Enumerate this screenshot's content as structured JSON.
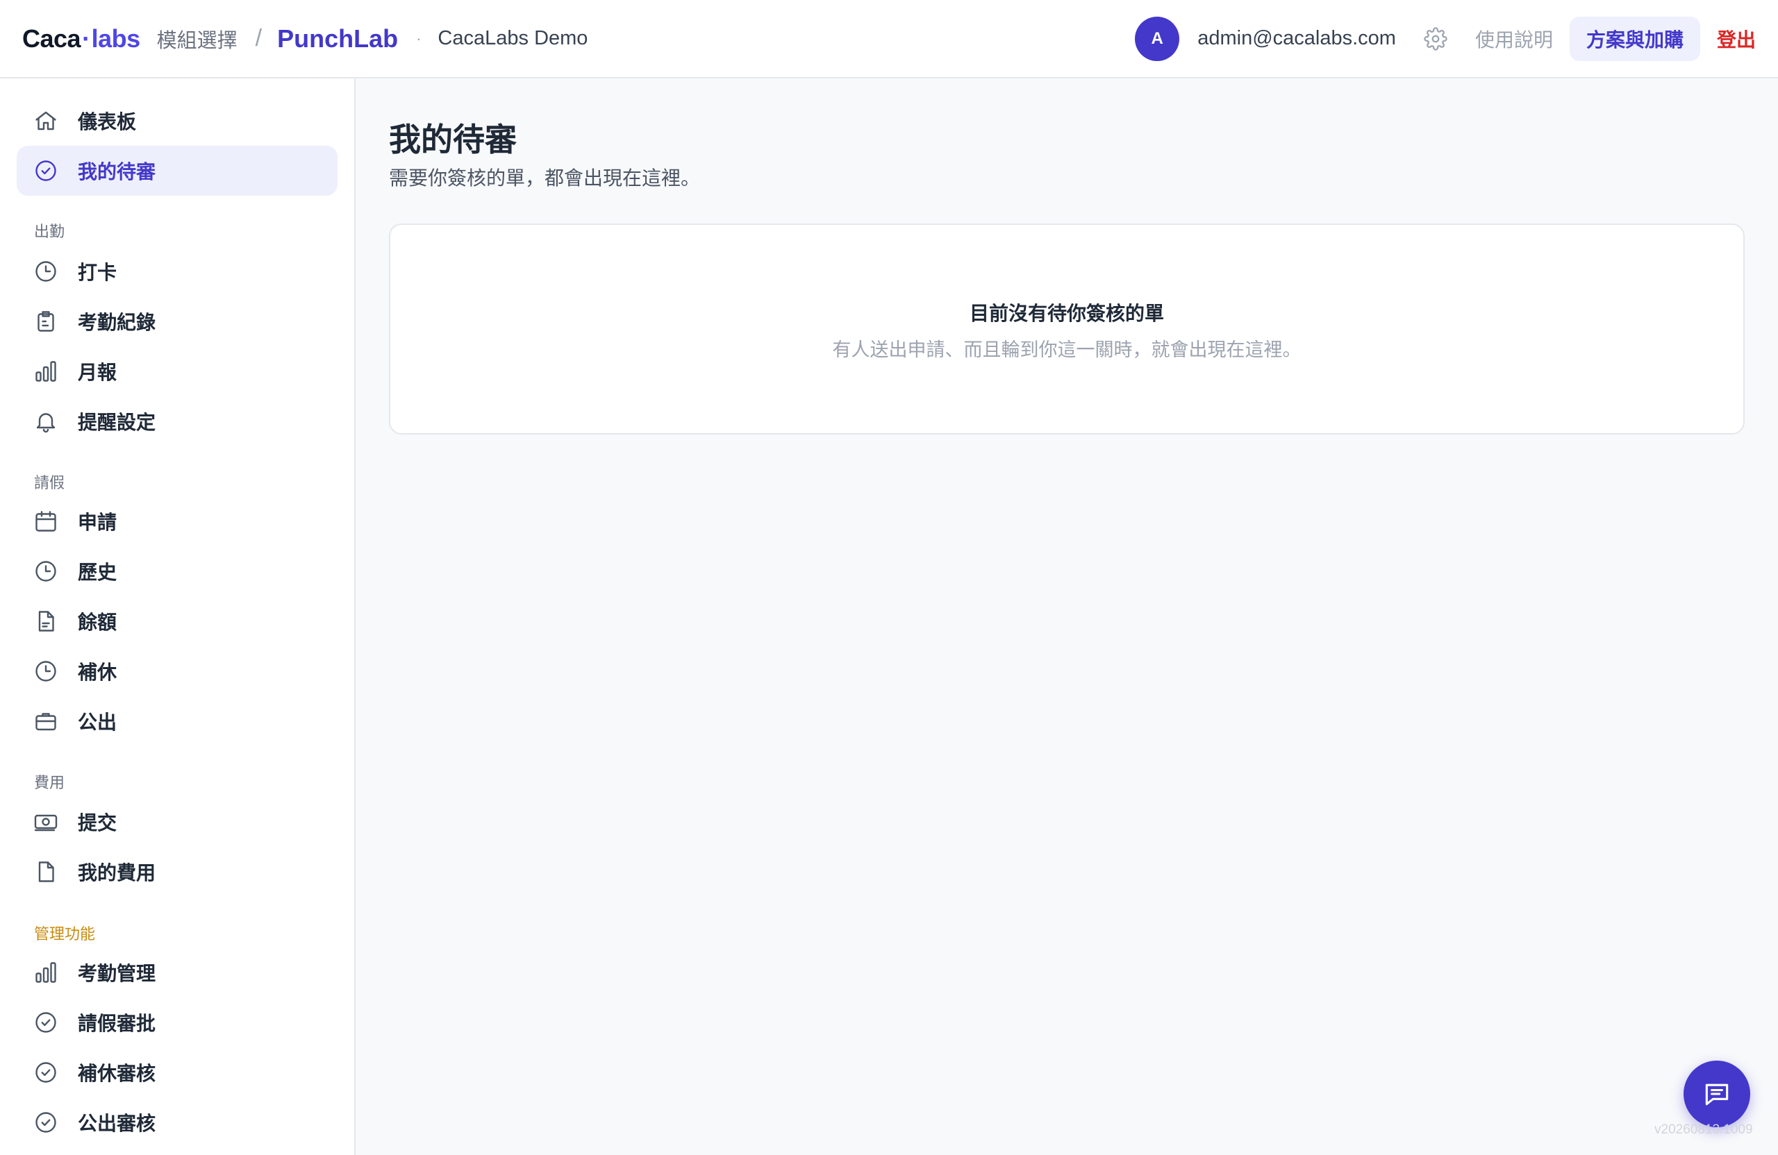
{
  "header": {
    "brand_main": "Caca",
    "brand_dot": "·",
    "brand_labs": "labs",
    "module_select": "模組選擇",
    "separator": "/",
    "app_name": "PunchLab",
    "dot": "·",
    "org_name": "CacaLabs Demo",
    "avatar_initial": "A",
    "email": "admin@cacalabs.com",
    "help_label": "使用說明",
    "plan_label": "方案與加購",
    "logout_label": "登出"
  },
  "sidebar": {
    "items_top": [
      {
        "label": "儀表板",
        "icon": "home-icon"
      },
      {
        "label": "我的待審",
        "icon": "check-circle-icon",
        "active": true
      }
    ],
    "section_attendance": "出勤",
    "items_attendance": [
      {
        "label": "打卡",
        "icon": "clock-icon"
      },
      {
        "label": "考勤紀錄",
        "icon": "clipboard-icon"
      },
      {
        "label": "月報",
        "icon": "bar-chart-icon"
      },
      {
        "label": "提醒設定",
        "icon": "bell-icon"
      }
    ],
    "section_leave": "請假",
    "items_leave": [
      {
        "label": "申請",
        "icon": "calendar-icon"
      },
      {
        "label": "歷史",
        "icon": "clock-icon"
      },
      {
        "label": "餘額",
        "icon": "document-icon"
      },
      {
        "label": "補休",
        "icon": "clock-icon"
      },
      {
        "label": "公出",
        "icon": "briefcase-icon"
      }
    ],
    "section_expense": "費用",
    "items_expense": [
      {
        "label": "提交",
        "icon": "money-icon"
      },
      {
        "label": "我的費用",
        "icon": "file-icon"
      }
    ],
    "section_admin": "管理功能",
    "items_admin": [
      {
        "label": "考勤管理",
        "icon": "bar-chart-icon"
      },
      {
        "label": "請假審批",
        "icon": "check-circle-icon"
      },
      {
        "label": "補休審核",
        "icon": "check-circle-icon"
      },
      {
        "label": "公出審核",
        "icon": "check-circle-icon"
      }
    ]
  },
  "main": {
    "title": "我的待審",
    "subtitle": "需要你簽核的單，都會出現在這裡。",
    "empty_title": "目前沒有待你簽核的單",
    "empty_desc": "有人送出申請、而且輪到你這一關時，就會出現在這裡。"
  },
  "footer": {
    "version": "v20260813.1009"
  },
  "colors": {
    "accent": "#4338ca",
    "active_bg": "#eeeffc",
    "logout": "#dc2626",
    "admin_section": "#c98b0b"
  }
}
